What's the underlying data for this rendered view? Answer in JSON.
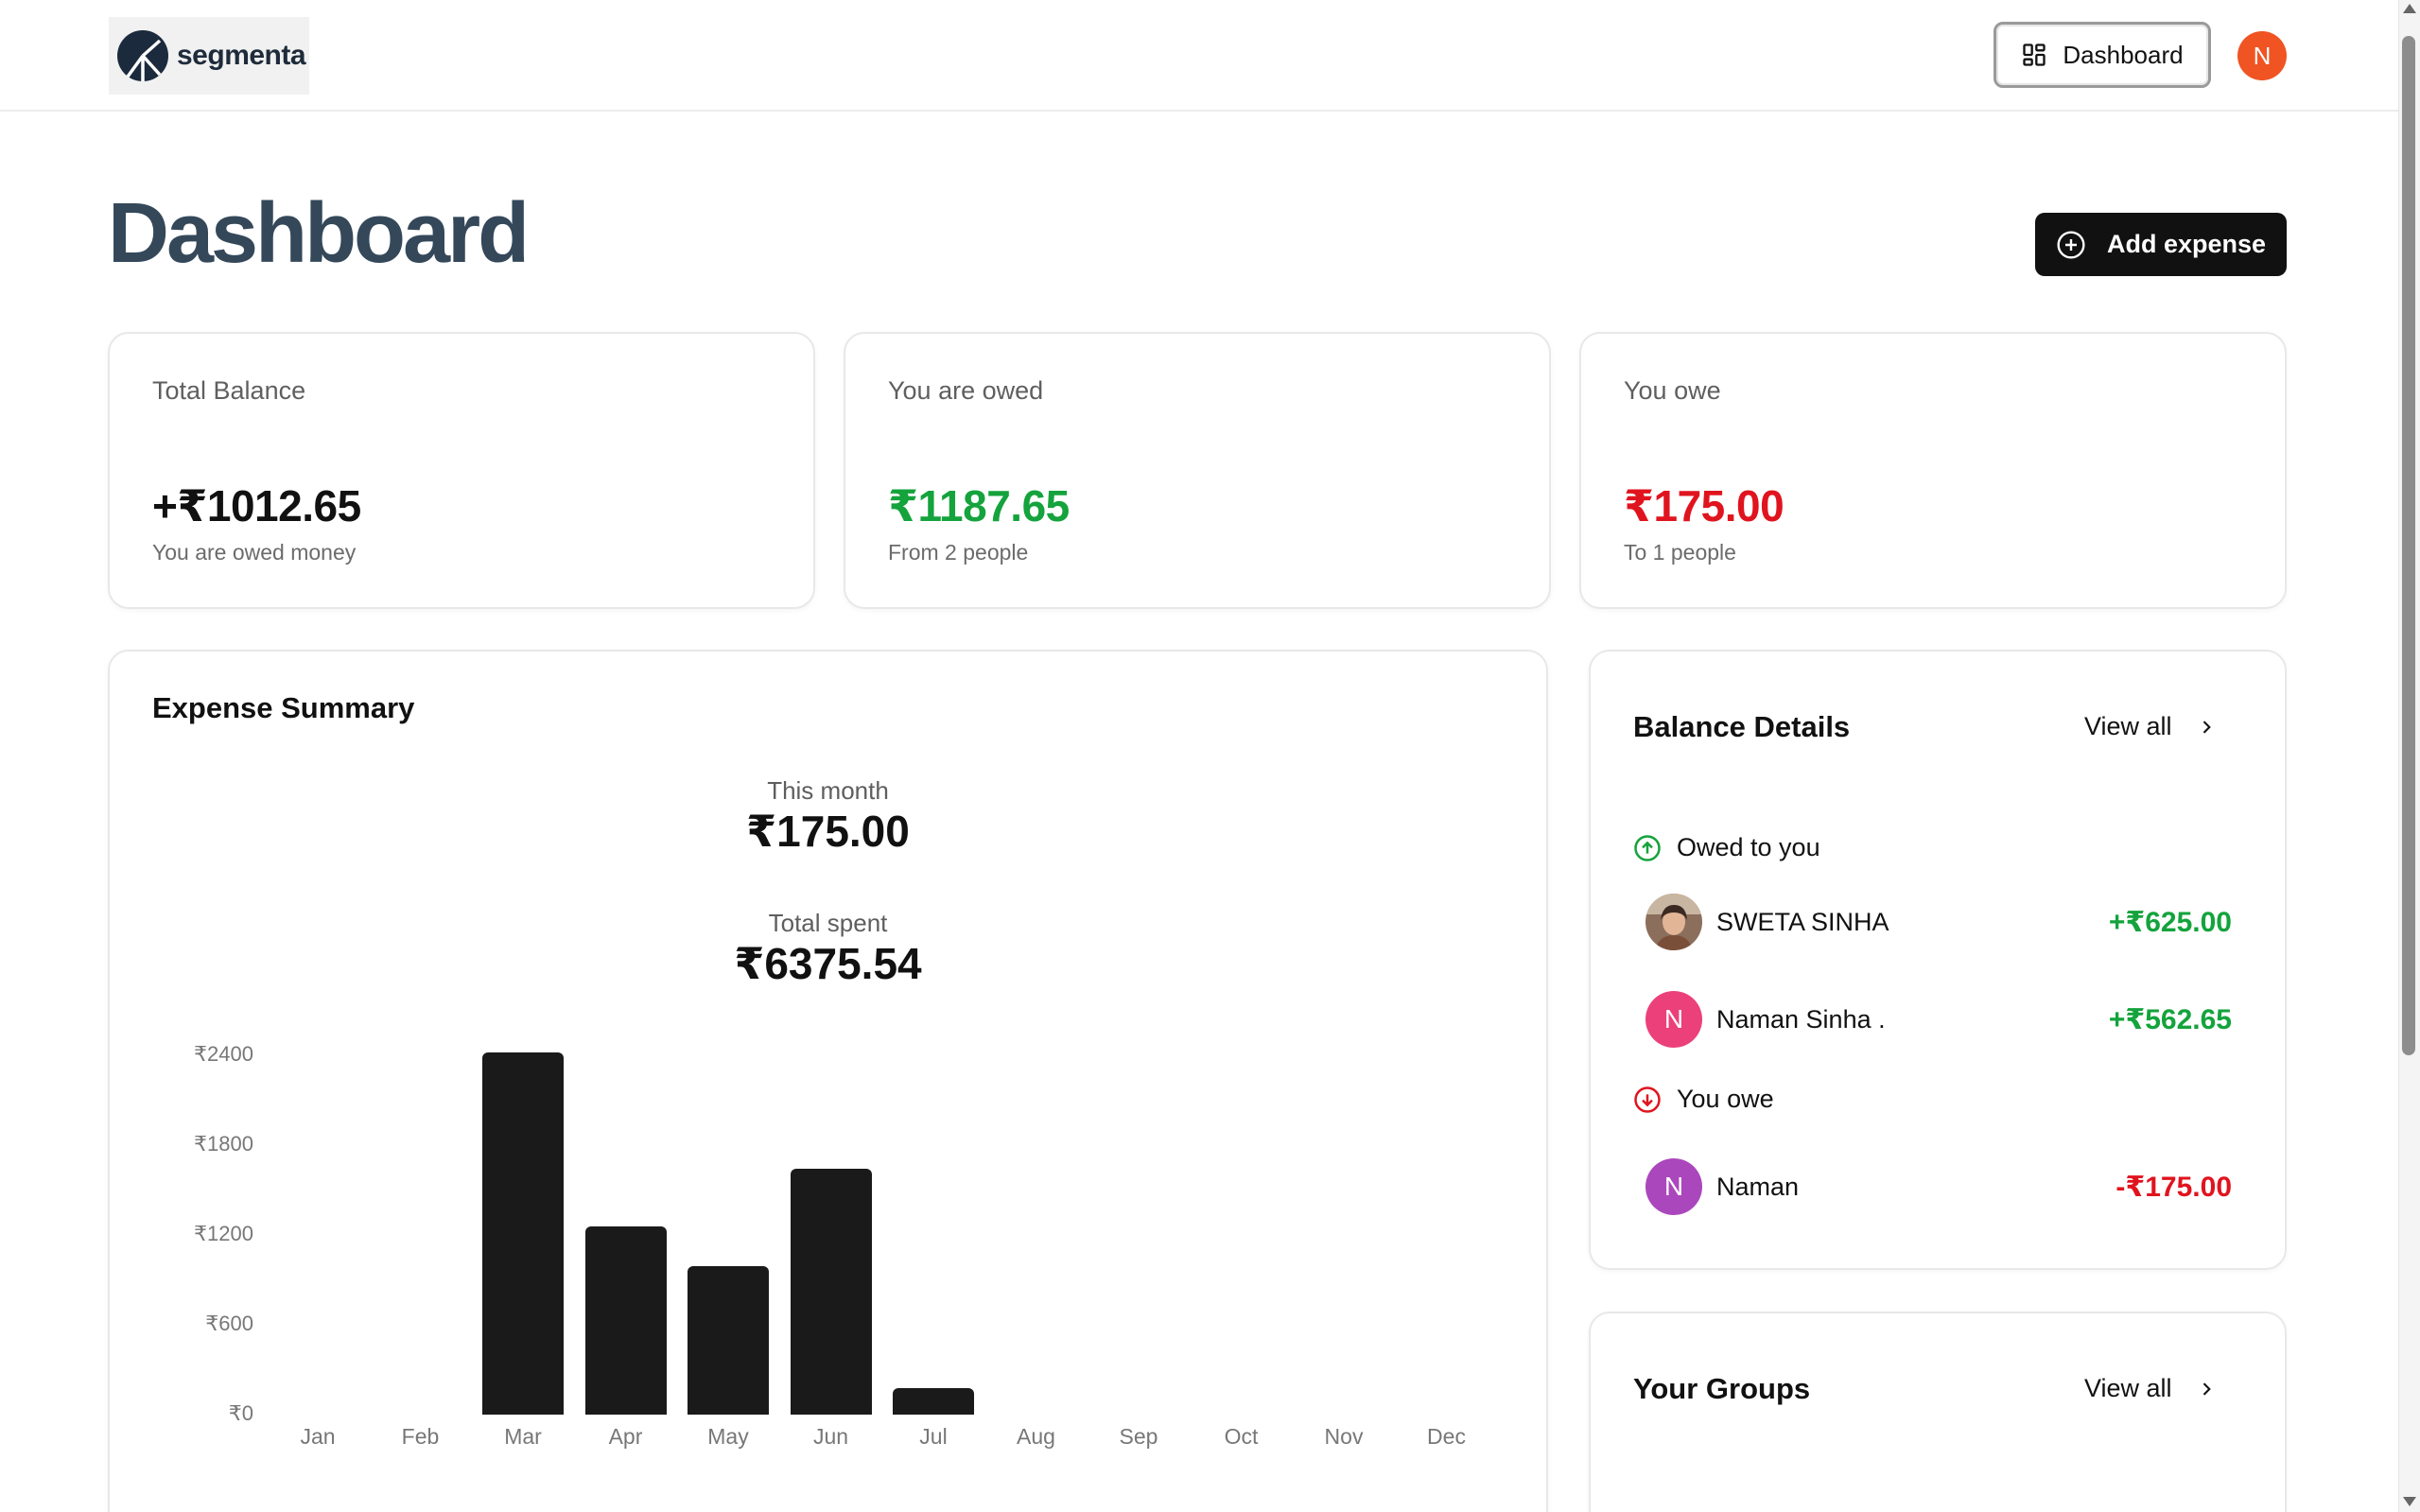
{
  "header": {
    "logo_text": "segmenta",
    "nav_label": "Dashboard",
    "user_initial": "N",
    "colors": {
      "avatar": "#f05423"
    }
  },
  "page": {
    "title": "Dashboard",
    "add_expense_label": "Add expense"
  },
  "stats": [
    {
      "label": "Total Balance",
      "value": "+₹1012.65",
      "sub": "You are owed money"
    },
    {
      "label": "You are owed",
      "value": "₹1187.65",
      "sub": "From 2 people"
    },
    {
      "label": "You owe",
      "value": "₹175.00",
      "sub": "To 1 people"
    }
  ],
  "expense_summary": {
    "title": "Expense Summary",
    "this_month_label": "This month",
    "this_month_value": "₹175.00",
    "total_spent_label": "Total spent",
    "total_spent_value": "₹6375.54"
  },
  "chart_data": {
    "type": "bar",
    "categories": [
      "Jan",
      "Feb",
      "Mar",
      "Apr",
      "May",
      "Jun",
      "Jul",
      "Aug",
      "Sep",
      "Oct",
      "Nov",
      "Dec"
    ],
    "values": [
      0,
      0,
      2420,
      1260,
      990,
      1640,
      175,
      0,
      0,
      0,
      0,
      0
    ],
    "ylim": [
      0,
      2400
    ],
    "yticks": [
      "₹0",
      "₹600",
      "₹1200",
      "₹1800",
      "₹2400"
    ],
    "ytick_values": [
      0,
      600,
      1200,
      1800,
      2400
    ],
    "grid": false,
    "bar_color": "#1a1a1a"
  },
  "balance_details": {
    "title": "Balance Details",
    "view_all": "View all",
    "owed_heading": "Owed to you",
    "owe_heading": "You owe",
    "owed_to_you": [
      {
        "name": "SWETA SINHA",
        "amount": "+₹625.00",
        "avatar": "photo"
      },
      {
        "name": "Naman Sinha .",
        "amount": "+₹562.65",
        "initial": "N",
        "color": "#ec407a"
      }
    ],
    "you_owe": [
      {
        "name": "Naman",
        "amount": "-₹175.00",
        "initial": "N",
        "color": "#ab47bc"
      }
    ]
  },
  "groups": {
    "title": "Your Groups",
    "view_all": "View all"
  },
  "colors": {
    "positive": "#14a33c",
    "negative": "#e0141e",
    "title": "#34485a",
    "button": "#111111"
  }
}
